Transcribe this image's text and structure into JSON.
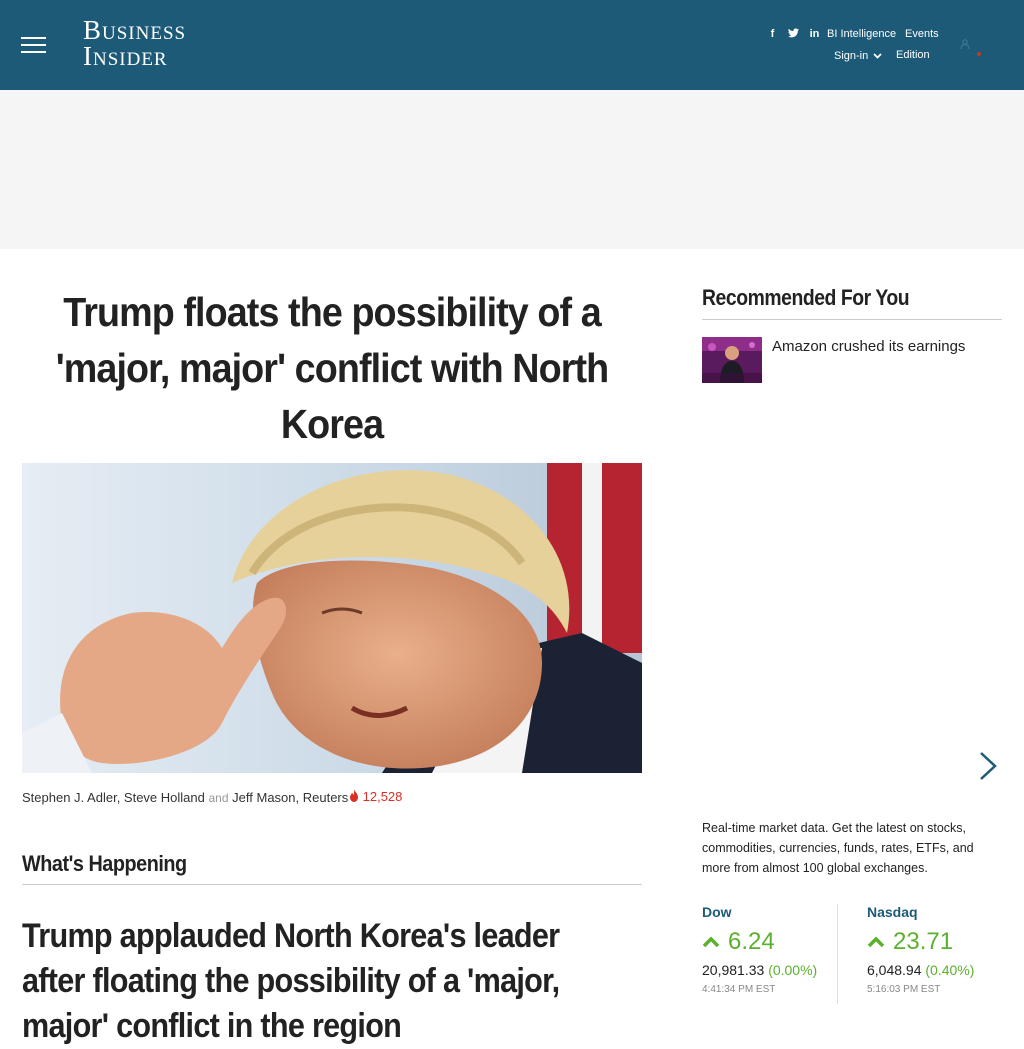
{
  "header": {
    "logo_line1": "Business",
    "logo_line2": "Insider",
    "social": [
      "f",
      "t",
      "in"
    ],
    "links": {
      "bi_intelligence": "BI Intelligence",
      "events": "Events",
      "sign_in": "Sign-in",
      "edition": "Edition"
    },
    "background_color": "#1c5a78"
  },
  "article": {
    "headline": "Trump floats the possibility of a 'major, major' conflict with North Korea",
    "authors": [
      "Stephen J. Adler",
      "Steve Holland",
      "Jeff Mason, Reuters"
    ],
    "and_word": "and",
    "views": "12,528",
    "view_icon": "flame-icon"
  },
  "whats_happening": {
    "title": "What's Happening",
    "story_headline": "Trump applauded North Korea's leader after floating the possibility of a 'major, major' conflict in the region"
  },
  "sidebar": {
    "recommended_title": "Recommended For You",
    "items": [
      {
        "label": "Amazon crushed its earnings"
      }
    ],
    "market_description": "Real-time market data. Get the latest on stocks, commodities, currencies, funds, rates, ETFs, and more from almost 100 global exchanges.",
    "markets": [
      {
        "name": "Dow",
        "change": "6.24",
        "value": "20,981.33",
        "percent": "(0.00%)",
        "time": "4:41:34 PM EST"
      },
      {
        "name": "Nasdaq",
        "change": "23.71",
        "value": "6,048.94",
        "percent": "(0.40%)",
        "time": "5:16:03 PM EST"
      }
    ],
    "up_color": "#5bb02e"
  }
}
